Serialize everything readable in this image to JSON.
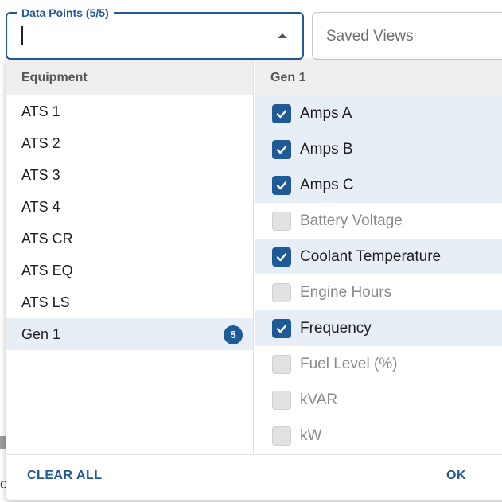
{
  "search": {
    "label": "Data Points (5/5)",
    "value": "",
    "placeholder": ""
  },
  "saved_views": {
    "label": "Saved Views"
  },
  "equipment": {
    "header": "Equipment",
    "items": [
      {
        "label": "ATS 1",
        "selected": false,
        "count": ""
      },
      {
        "label": "ATS 2",
        "selected": false,
        "count": ""
      },
      {
        "label": "ATS 3",
        "selected": false,
        "count": ""
      },
      {
        "label": "ATS 4",
        "selected": false,
        "count": ""
      },
      {
        "label": "ATS CR",
        "selected": false,
        "count": ""
      },
      {
        "label": "ATS EQ",
        "selected": false,
        "count": ""
      },
      {
        "label": "ATS LS",
        "selected": false,
        "count": ""
      },
      {
        "label": "Gen 1",
        "selected": true,
        "count": "5"
      }
    ]
  },
  "data_points": {
    "header": "Gen 1",
    "items": [
      {
        "label": "Amps A",
        "checked": true
      },
      {
        "label": "Amps B",
        "checked": true
      },
      {
        "label": "Amps C",
        "checked": true
      },
      {
        "label": "Battery Voltage",
        "checked": false
      },
      {
        "label": "Coolant Temperature",
        "checked": true
      },
      {
        "label": "Engine Hours",
        "checked": false
      },
      {
        "label": "Frequency",
        "checked": true
      },
      {
        "label": "Fuel Level (%)",
        "checked": false
      },
      {
        "label": "kVAR",
        "checked": false
      },
      {
        "label": "kW",
        "checked": false
      }
    ]
  },
  "footer": {
    "clear_label": "CLEAR ALL",
    "ok_label": "OK"
  },
  "colors": {
    "accent": "#1f5a96",
    "selected_row": "#e8eef6",
    "header_bg": "#eeeeee"
  }
}
